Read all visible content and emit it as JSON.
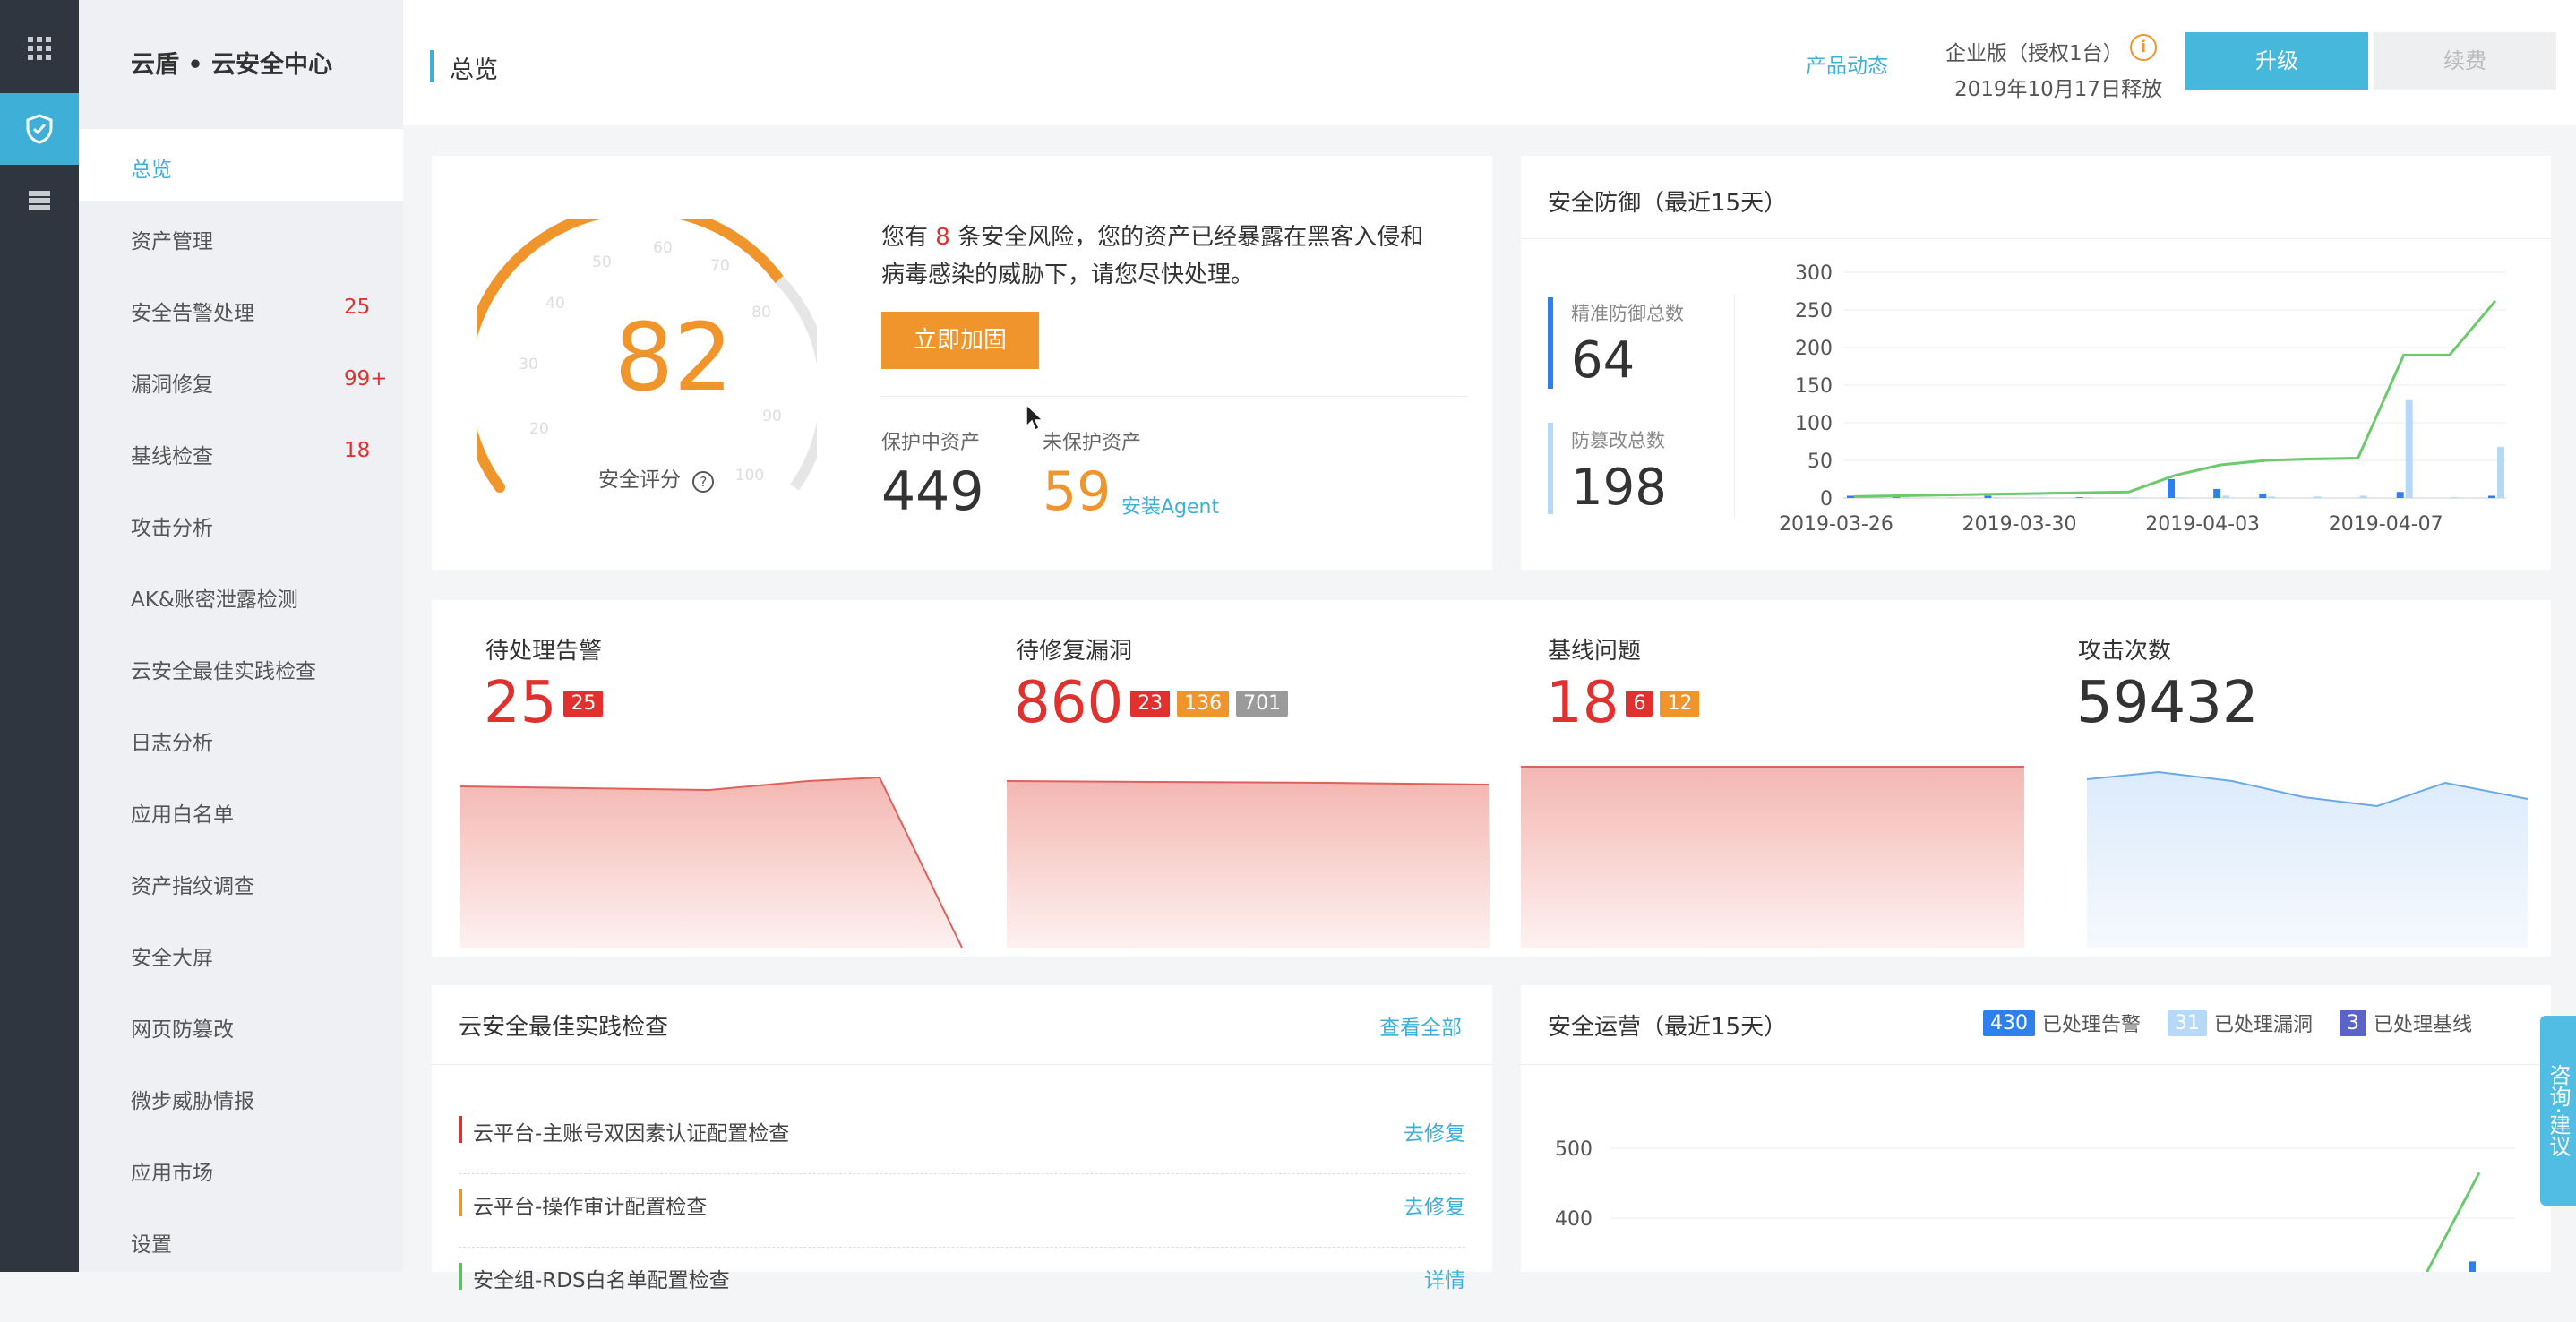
{
  "rail": {
    "icons": [
      "apps-grid-icon",
      "shield-icon",
      "server-icon"
    ]
  },
  "sidebar": {
    "brand": "云盾 • 云安全中心",
    "items": [
      {
        "label": "总览",
        "count": ""
      },
      {
        "label": "资产管理",
        "count": ""
      },
      {
        "label": "安全告警处理",
        "count": "25"
      },
      {
        "label": "漏洞修复",
        "count": "99+"
      },
      {
        "label": "基线检查",
        "count": "18"
      },
      {
        "label": "攻击分析",
        "count": ""
      },
      {
        "label": "AK&账密泄露检测",
        "count": ""
      },
      {
        "label": "云安全最佳实践检查",
        "count": ""
      },
      {
        "label": "日志分析",
        "count": ""
      },
      {
        "label": "应用白名单",
        "count": ""
      },
      {
        "label": "资产指纹调查",
        "count": ""
      },
      {
        "label": "安全大屏",
        "count": ""
      },
      {
        "label": "网页防篡改",
        "count": ""
      },
      {
        "label": "微步威胁情报",
        "count": ""
      },
      {
        "label": "应用市场",
        "count": ""
      },
      {
        "label": "设置",
        "count": ""
      }
    ]
  },
  "header": {
    "breadcrumb": "总览",
    "product_news": "产品动态",
    "edition": "企业版（授权1台）",
    "release": "2019年10月17日释放",
    "upgrade_label": "升级",
    "renew_label": "续费"
  },
  "score": {
    "value": "82",
    "label": "安全评分",
    "ticks": [
      "20",
      "30",
      "40",
      "50",
      "60",
      "70",
      "80",
      "90",
      "100"
    ],
    "risk_prefix": "您有",
    "risk_count": "8",
    "risk_suffix": "条安全风险，您的资产已经暴露在黑客入侵和",
    "risk_line2": "病毒感染的威胁下，请您尽快处理。",
    "fix_label": "立即加固",
    "protected_label": "保护中资产",
    "protected_value": "449",
    "unprotected_label": "未保护资产",
    "unprotected_value": "59",
    "install_agent": "安装Agent"
  },
  "defense": {
    "title": "安全防御（最近15天）",
    "precise_label": "精准防御总数",
    "precise_value": "64",
    "tamper_label": "防篡改总数",
    "tamper_value": "198"
  },
  "stats": [
    {
      "title": "待处理告警",
      "value": "25",
      "tags": [
        "25"
      ]
    },
    {
      "title": "待修复漏洞",
      "value": "860",
      "tags": [
        "23",
        "136",
        "701"
      ]
    },
    {
      "title": "基线问题",
      "value": "18",
      "tags": [
        "6",
        "12"
      ]
    },
    {
      "title": "攻击次数",
      "value": "59432",
      "tags": []
    }
  ],
  "best_practice": {
    "title": "云安全最佳实践检查",
    "view_all": "查看全部",
    "rows": [
      {
        "label": "云平台-主账号双因素认证配置检查",
        "action": "去修复",
        "color": "#e0312f"
      },
      {
        "label": "云平台-操作审计配置检查",
        "action": "去修复",
        "color": "#f0952c"
      },
      {
        "label": "安全组-RDS白名单配置检查",
        "action": "详情",
        "color": "#5cc05c"
      }
    ]
  },
  "operations": {
    "title": "安全运营（最近15天）",
    "legend": [
      {
        "count": "430",
        "label": "已处理告警",
        "color": "#2f80ed"
      },
      {
        "count": "31",
        "label": "已处理漏洞",
        "color": "#b6d9f7"
      },
      {
        "count": "3",
        "label": "已处理基线",
        "color": "#5b63c7"
      }
    ]
  },
  "consult": {
    "label": "咨询·建议"
  },
  "colors": {
    "accent": "#3eb0d8",
    "danger": "#e0312f",
    "warning": "#f0952c",
    "green": "#5cc05c"
  },
  "chart_data": [
    {
      "type": "line",
      "title": "安全防御（最近15天）",
      "x": [
        "2019-03-26",
        "2019-03-27",
        "2019-03-28",
        "2019-03-29",
        "2019-03-30",
        "2019-03-31",
        "2019-04-01",
        "2019-04-02",
        "2019-04-03",
        "2019-04-04",
        "2019-04-05",
        "2019-04-06",
        "2019-04-07",
        "2019-04-08",
        "2019-04-09"
      ],
      "xticks": [
        "2019-03-26",
        "2019-03-30",
        "2019-04-03",
        "2019-04-07"
      ],
      "ylim": [
        0,
        300
      ],
      "yticks": [
        0,
        50,
        100,
        150,
        200,
        250,
        300
      ],
      "series": [
        {
          "kind": "line",
          "values": [
            2,
            3,
            4,
            5,
            6,
            7,
            8,
            30,
            44,
            50,
            52,
            53,
            190,
            190,
            262
          ]
        },
        {
          "kind": "bar",
          "values": [
            3,
            1,
            0,
            3,
            0,
            1,
            0,
            25,
            12,
            6,
            0,
            0,
            8,
            0,
            3
          ]
        },
        {
          "kind": "bar",
          "values": [
            1,
            1,
            1,
            1,
            1,
            1,
            1,
            1,
            3,
            2,
            2,
            3,
            130,
            1,
            68
          ]
        }
      ],
      "grid": true
    },
    {
      "type": "line",
      "ylim": [
        300,
        520
      ],
      "yticks": [
        300,
        400,
        500
      ],
      "series": [
        {
          "kind": "line",
          "values": [
            300,
            300,
            300,
            300,
            300,
            300,
            300,
            300,
            300,
            300,
            300,
            300,
            300,
            300,
            465
          ]
        },
        {
          "kind": "bar",
          "values": [
            0,
            0,
            0,
            0,
            0,
            0,
            0,
            0,
            0,
            0,
            0,
            0,
            0,
            0,
            338
          ]
        }
      ]
    }
  ]
}
